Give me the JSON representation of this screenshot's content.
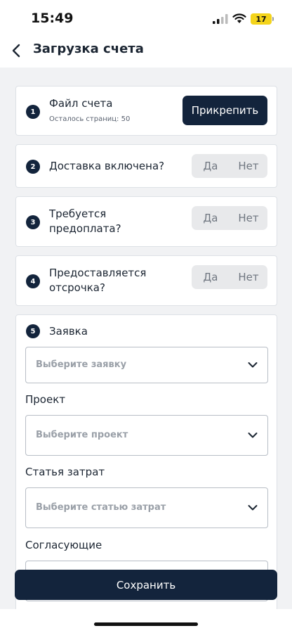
{
  "status_bar": {
    "time": "15:49",
    "battery": "17",
    "icons": [
      "signal-icon",
      "wifi-icon",
      "battery-icon"
    ]
  },
  "nav": {
    "title": "Загрузка счета",
    "back_icon": "chevron-left-icon"
  },
  "steps": [
    {
      "number": "1",
      "title": "Файл счета",
      "subtitle": "Осталось страниц: 50",
      "action": "Прикрепить"
    },
    {
      "number": "2",
      "title": "Доставка включена?",
      "yes": "Да",
      "no": "Нет"
    },
    {
      "number": "3",
      "title_line1": "Требуется",
      "title_line2": "предоплата?",
      "yes": "Да",
      "no": "Нет"
    },
    {
      "number": "4",
      "title_line1": "Предоставляется",
      "title_line2": "отсрочка?",
      "yes": "Да",
      "no": "Нет"
    },
    {
      "number": "5",
      "title": "Заявка",
      "request_placeholder": "Выберите заявку",
      "project_label": "Проект",
      "project_placeholder": "Выберите проект",
      "cost_label": "Статья затрат",
      "cost_placeholder": "Выберите статью затрат",
      "approvers_label": "Согласующие"
    }
  ],
  "footer": {
    "save_label": "Сохранить"
  },
  "colors": {
    "primary": "#13243c",
    "background": "#f1f2f4",
    "battery": "#f4d41b"
  }
}
